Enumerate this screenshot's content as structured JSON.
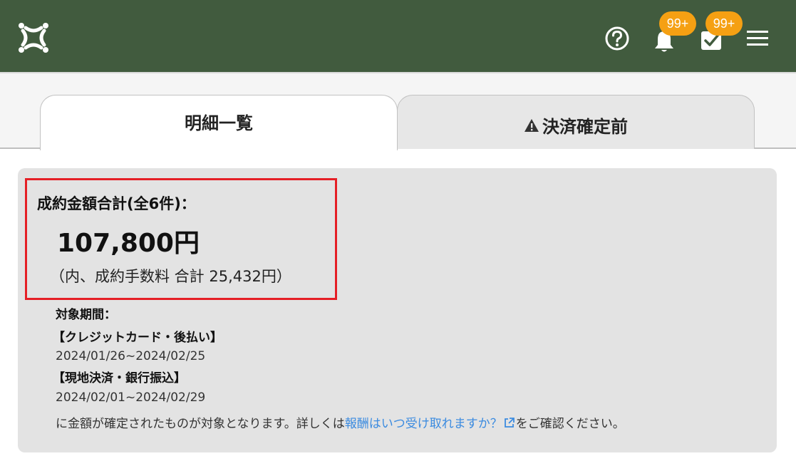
{
  "header": {
    "notifications_badge": "99+",
    "tasks_badge": "99+",
    "icons": [
      "logo-icon",
      "help-icon",
      "bell-icon",
      "check-icon",
      "menu-icon"
    ],
    "background_color": "#415b3e",
    "badge_color": "#f5a013"
  },
  "tabs": [
    {
      "label": "明細一覧",
      "active": true
    },
    {
      "label": "決済確定前",
      "active": false,
      "icon": "warning-icon"
    }
  ],
  "summary": {
    "total_label": "成約金額合計(全6件)：",
    "total_amount": "107,800円",
    "fee_line": "（内、成約手数料 合計 25,432円）",
    "period_label": "対象期間：",
    "methods": [
      {
        "name": "【クレジットカード・後払い】",
        "range": "2024/01/26~2024/02/25"
      },
      {
        "name": "【現地決済・銀行振込】",
        "range": "2024/02/01~2024/02/29"
      }
    ],
    "note_before": "に金額が確定されたものが対象となります。詳しくは",
    "note_link": "報酬はいつ受け取れますか？",
    "note_after": "をご確認ください。",
    "link_color": "#3b8be0",
    "highlight_color": "#e51f26"
  }
}
